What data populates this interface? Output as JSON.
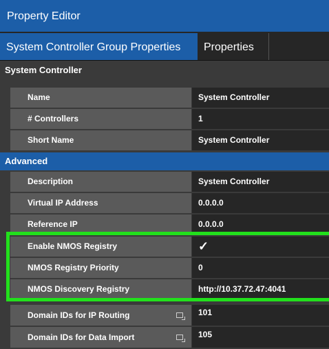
{
  "window": {
    "title": "Property Editor"
  },
  "tabs": [
    {
      "label": "System Controller Group Properties"
    },
    {
      "label": "Properties"
    }
  ],
  "sections": {
    "system_controller": "System Controller",
    "advanced": "Advanced"
  },
  "rows": [
    {
      "label": "Name",
      "value": "System Controller"
    },
    {
      "label": "# Controllers",
      "value": "1"
    },
    {
      "label": "Short Name",
      "value": "System Controller"
    },
    {
      "label": "Description",
      "value": "System Controller"
    },
    {
      "label": "Virtual IP Address",
      "value": "0.0.0.0"
    },
    {
      "label": "Reference IP",
      "value": "0.0.0.0"
    },
    {
      "label": "Enable NMOS Registry",
      "value": "✓"
    },
    {
      "label": "NMOS Registry Priority",
      "value": "0"
    },
    {
      "label": "NMOS Discovery Registry",
      "value": "http://10.37.72.47:4041"
    },
    {
      "label": "Domain IDs for IP Routing",
      "value": "101"
    },
    {
      "label": "Domain IDs for Data Import",
      "value": "105"
    }
  ],
  "colors": {
    "accent": "#1c5ea8",
    "highlight": "#22e01c",
    "label_bg": "#5a5a5a",
    "value_bg": "#262626"
  },
  "icons": {
    "list_edit": "list-edit-icon"
  }
}
